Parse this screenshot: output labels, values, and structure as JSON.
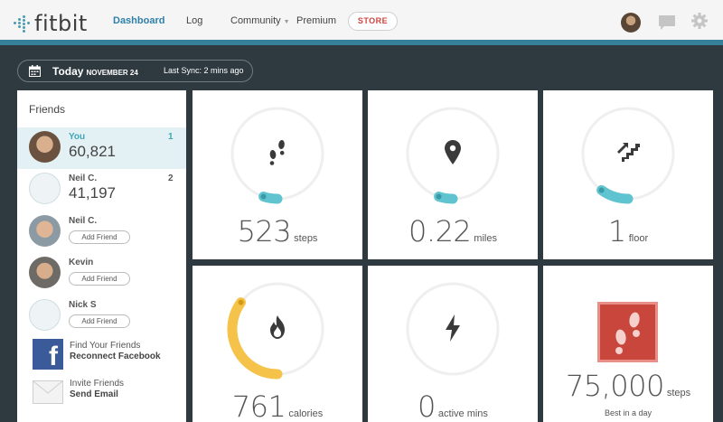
{
  "nav": {
    "logo": "fitbit",
    "items": [
      "Dashboard",
      "Log",
      "Community",
      "Premium"
    ],
    "store": "STORE"
  },
  "date_bar": {
    "today": "Today",
    "date": "NOVEMBER 24",
    "sync": "Last Sync: 2 mins ago"
  },
  "friends": {
    "title": "Friends",
    "list": [
      {
        "name": "You",
        "steps": "60,821",
        "rank": "1"
      },
      {
        "name": "Neil C.",
        "steps": "41,197",
        "rank": "2"
      },
      {
        "name": "Neil C.",
        "action": "Add Friend"
      },
      {
        "name": "Kevin",
        "action": "Add Friend"
      },
      {
        "name": "Nick S",
        "action": "Add Friend"
      }
    ],
    "facebook": {
      "line1": "Find Your Friends",
      "line2": "Reconnect Facebook"
    },
    "email": {
      "line1": "Invite Friends",
      "line2": "Send Email"
    }
  },
  "tiles": [
    {
      "value": "523",
      "unit": "steps",
      "icon": "footsteps-icon",
      "progress": 0.05
    },
    {
      "value": "0.22",
      "unit": "miles",
      "icon": "location-pin-icon",
      "progress": 0.05
    },
    {
      "value": "1",
      "unit": "floor",
      "icon": "stairs-icon",
      "progress": 0.1
    },
    {
      "value": "761",
      "unit": "calories",
      "icon": "flame-icon",
      "progress": 0.35
    },
    {
      "value": "0",
      "unit": "active mins",
      "icon": "lightning-icon",
      "progress": 0
    },
    {
      "value": "75,000",
      "unit": "steps",
      "icon": "footsteps-badge-icon",
      "caption": "Best in a day"
    }
  ],
  "colors": {
    "accent": "#36809a",
    "progress_teal": "#5fc4cf",
    "calories_yellow": "#f5c24a",
    "badge_red": "#c8463c",
    "background": "#2e3a40",
    "store_red": "#d0433e"
  }
}
